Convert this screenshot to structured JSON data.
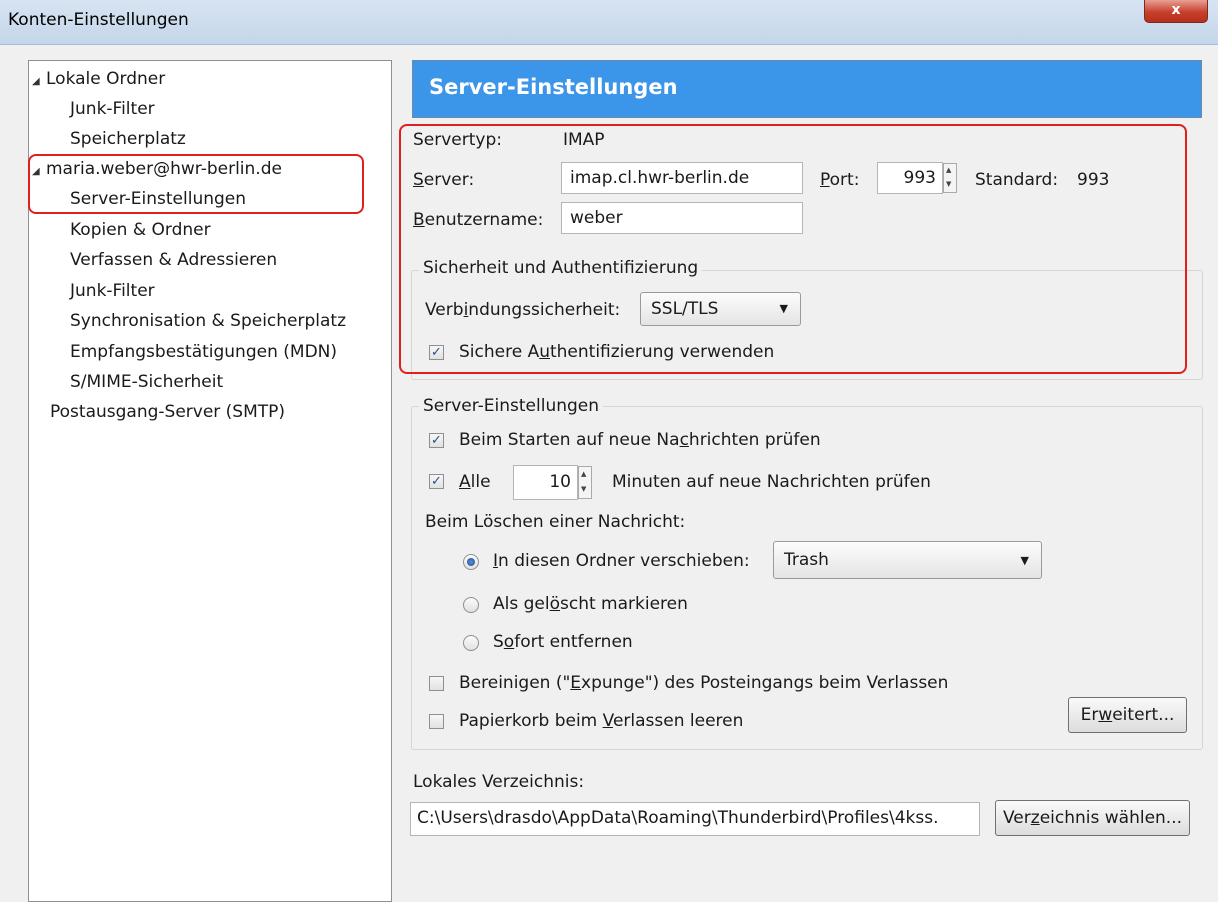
{
  "window": {
    "title": "Konten-Einstellungen",
    "close_glyph": "x"
  },
  "sidebar": {
    "items": [
      {
        "label": "Lokale Ordner"
      },
      {
        "label": "Junk-Filter"
      },
      {
        "label": "Speicherplatz"
      },
      {
        "label": "maria.weber@hwr-berlin.de"
      },
      {
        "label": "Server-Einstellungen"
      },
      {
        "label": "Kopien & Ordner"
      },
      {
        "label": "Verfassen & Adressieren"
      },
      {
        "label": "Junk-Filter"
      },
      {
        "label": "Synchronisation & Speicherplatz"
      },
      {
        "label": "Empfangsbestätigungen (MDN)"
      },
      {
        "label": "S/MIME-Sicherheit"
      },
      {
        "label": "Postausgang-Server (SMTP)"
      }
    ]
  },
  "header": {
    "title": "Server-Einstellungen"
  },
  "server": {
    "type_label": "Servertyp:",
    "type_value": "IMAP",
    "server_label": "Server:",
    "server_value": "imap.cl.hwr-berlin.de",
    "port_label": "Port:",
    "port_value": "993",
    "standard_label": "Standard:",
    "standard_value": "993",
    "username_label": "Benutzername:",
    "username_value": "weber"
  },
  "security": {
    "group_title": "Sicherheit und Authentifizierung",
    "connection_label": "Verbindungssicherheit:",
    "connection_value": "SSL/TLS",
    "secure_auth_label": "Sichere Authentifizierung verwenden",
    "secure_auth_checked": true
  },
  "server_settings": {
    "group_title": "Server-Einstellungen",
    "check_on_start_label": "Beim Starten auf neue Nachrichten prüfen",
    "check_every_label": "Alle",
    "check_every_value": "10",
    "minutes_label": "Minuten auf neue Nachrichten prüfen",
    "delete_label": "Beim Löschen einer Nachricht:",
    "move_to_folder_label": "In diesen Ordner verschieben:",
    "folder_value": "Trash",
    "mark_deleted_label": "Als gelöscht markieren",
    "remove_immediately_label": "Sofort entfernen",
    "expunge_label": "Bereinigen (\"Expunge\") des Posteingangs beim Verlassen",
    "empty_trash_label": "Papierkorb beim Verlassen leeren",
    "advanced_button": "Erweitert..."
  },
  "local_dir": {
    "label": "Lokales Verzeichnis:",
    "path": "C:\\Users\\drasdo\\AppData\\Roaming\\Thunderbird\\Profiles\\4kss.",
    "choose_button": "Verzeichnis wählen..."
  },
  "colors": {
    "banner": "#3b95e8",
    "highlight": "#e02020"
  }
}
